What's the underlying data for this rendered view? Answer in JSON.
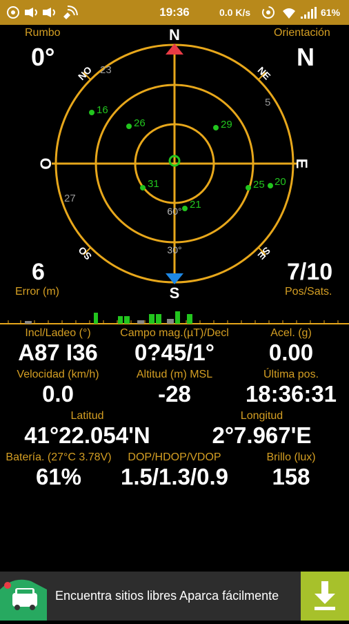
{
  "status_bar": {
    "time": "19:36",
    "net_speed": "0.0 K/s",
    "battery": "61%",
    "color": "#b8891b",
    "icons": [
      "location-icon",
      "volte-icon",
      "volte-icon",
      "wifi-calling-icon",
      "hotspot-icon",
      "wifi-icon",
      "signal-icon"
    ]
  },
  "compass": {
    "rumbo_label": "Rumbo",
    "rumbo_value": "0°",
    "orient_label": "Orientación",
    "orient_value": "N",
    "error_value": "6",
    "error_label": "Error (m)",
    "pos_value": "7/10",
    "pos_label": "Pos/Sats.",
    "cardinals": {
      "N": "N",
      "S": "S",
      "E": "E",
      "O": "O",
      "NE": "NE",
      "NO": "NO",
      "SE": "SE",
      "SO": "SO"
    },
    "elev_labels": {
      "e60": "60°",
      "e30": "30°"
    },
    "ring_color": "#e7a71b",
    "satellites": [
      {
        "id": "23",
        "used": false
      },
      {
        "id": "5",
        "used": false
      },
      {
        "id": "16",
        "used": true
      },
      {
        "id": "26",
        "used": true
      },
      {
        "id": "29",
        "used": true
      },
      {
        "id": "31",
        "used": true
      },
      {
        "id": "25",
        "used": true
      },
      {
        "id": "20",
        "used": true
      },
      {
        "id": "21",
        "used": true
      },
      {
        "id": "27",
        "used": false
      }
    ]
  },
  "rows": {
    "r1": {
      "l1": "Incl/Ladeo (°)",
      "v1": "A87 I36",
      "l2": "Campo mag.(µT)/Decl",
      "v2": "0?45/1°",
      "l3": "Acel. (g)",
      "v3": "0.00"
    },
    "r2": {
      "l1": "Velocidad (km/h)",
      "v1": "0.0",
      "l2": "Altitud (m) MSL",
      "v2": "-28",
      "l3": "Última pos.",
      "v3": "18:36:31"
    },
    "r3": {
      "l1": "Latitud",
      "v1": "41°22.054'N",
      "l2": "Longitud",
      "v2": "2°7.967'E"
    },
    "r4": {
      "l1": "Batería. (27°C 3.78V)",
      "v1": "61%",
      "l2": "DOP/HDOP/VDOP",
      "v2": "1.5/1.3/0.9",
      "l3": "Brillo (lux)",
      "v3": "158"
    }
  },
  "ad": {
    "text": "Encuentra sitios libres Aparca fácilmente",
    "button_icon": "download-icon",
    "logo_icon": "car-logo-icon"
  }
}
